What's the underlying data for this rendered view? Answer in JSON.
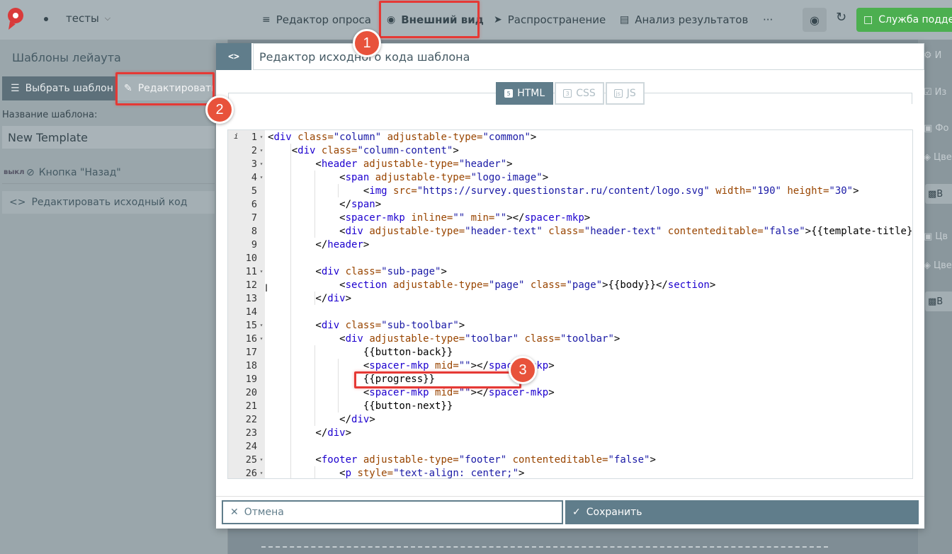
{
  "topbar": {
    "project_label": "тесты",
    "nav": [
      {
        "label": "Редактор опроса",
        "icon": "edit-list-icon"
      },
      {
        "label": "Внешний вид",
        "icon": "palette-icon"
      },
      {
        "label": "Распространение",
        "icon": "send-icon"
      },
      {
        "label": "Анализ результатов",
        "icon": "bar-chart-icon"
      },
      {
        "label": "···",
        "icon": "more-icon"
      }
    ],
    "support_label": "Служба поддерж"
  },
  "left_panel": {
    "title": "Шаблоны лейаута",
    "tab_select": "Выбрать шаблон",
    "tab_edit": "Редактировать",
    "name_label": "Название шаблона:",
    "name_value": "New Template",
    "toggle_state": "выкл",
    "toggle_label": "Кнопка \"Назад\"",
    "source_label": "Редактировать исходный код"
  },
  "right_strip": {
    "items": [
      "И",
      "Из",
      "Фо",
      "Цве",
      "В",
      "Цв",
      "Цве",
      "В"
    ]
  },
  "modal": {
    "toggle_symbol": "<>",
    "title": "Редактор исходного кода шаблона",
    "tabs": [
      "HTML",
      "CSS",
      "JS"
    ],
    "cancel_label": "Отмена",
    "save_label": "Сохранить"
  },
  "editor": {
    "info_marker": "i",
    "line_numbers": [
      "1",
      "2",
      "3",
      "4",
      "5",
      "6",
      "7",
      "8",
      "9",
      "10",
      "11",
      "12",
      "13",
      "14",
      "15",
      "16",
      "17",
      "18",
      "19",
      "20",
      "21",
      "22",
      "23",
      "24",
      "25",
      "26"
    ]
  },
  "annotations": [
    "1",
    "2",
    "3"
  ],
  "colors": {
    "accent": "#607d8b",
    "support_green": "#4caf50",
    "highlight_red": "#e53935",
    "step_badge": "#e8523b"
  }
}
